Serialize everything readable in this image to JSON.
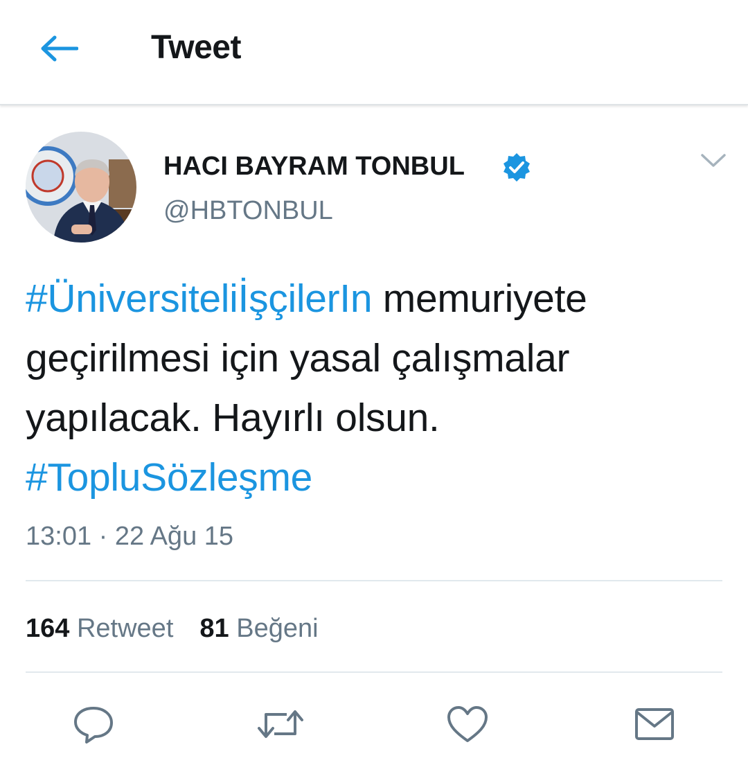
{
  "header": {
    "title": "Tweet",
    "back_icon": "arrow-left-icon"
  },
  "author": {
    "name": "HACI BAYRAM TONBUL",
    "handle": "@HBTONBUL",
    "verified_icon": "verified-badge-icon"
  },
  "tweet": {
    "hashtag_1": "#ÜniversiteliİşçilerIn",
    "text_1": " memuriyete geçirilmesi için yasal çalışmalar yapılacak. Hayırlı olsun.",
    "hashtag_2": "#TopluSözleşme",
    "timestamp": "13:01 · 22 Ağu 15"
  },
  "stats": {
    "retweet_count": "164",
    "retweet_label": "Retweet",
    "like_count": "81",
    "like_label": "Beğeni"
  },
  "actions": [
    "reply-icon",
    "retweet-icon",
    "like-icon",
    "message-icon"
  ],
  "colors": {
    "accent": "#1b95e0",
    "text": "#14171a",
    "muted": "#657786",
    "divider": "#e1e8ed"
  }
}
